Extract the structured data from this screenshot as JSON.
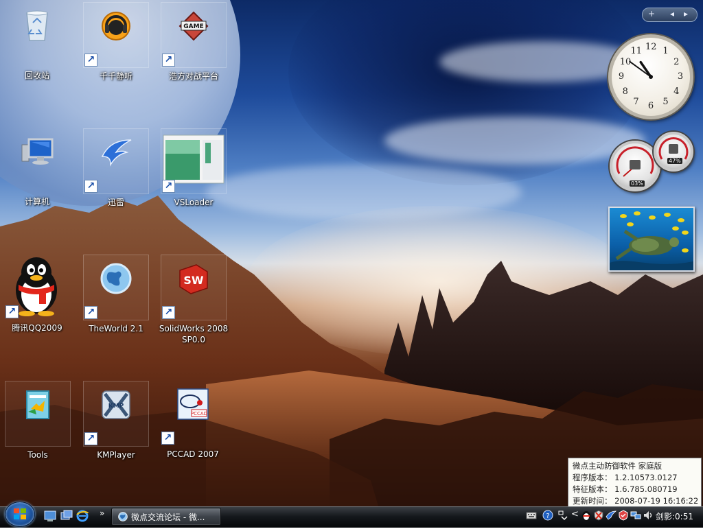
{
  "desktop_icons": [
    {
      "label": "回收站"
    },
    {
      "label": "千千静听"
    },
    {
      "label": "浩方对战平台"
    },
    {
      "label": "计算机"
    },
    {
      "label": "迅雷"
    },
    {
      "label": "VSLoader"
    },
    {
      "label": "腾讯QQ2009"
    },
    {
      "label": "TheWorld 2.1"
    },
    {
      "label": "SolidWorks 2008 SP0.0"
    },
    {
      "label": "Tools"
    },
    {
      "label": "KMPlayer"
    },
    {
      "label": "PCCAD 2007"
    }
  ],
  "gadgets": {
    "sidebar_controls": {
      "add": "+",
      "prev": "◂",
      "next": "▸"
    },
    "clock": {
      "hour": 10,
      "minute": 51,
      "numerals": [
        "12",
        "1",
        "2",
        "3",
        "4",
        "5",
        "6",
        "7",
        "8",
        "9",
        "10",
        "11"
      ]
    },
    "cpu_meter": {
      "cpu_value": "03%",
      "memory_value": "47%"
    },
    "slideshow_icon": "sea-turtle-photo"
  },
  "notification": {
    "line1": "微点主动防御软件  家庭版",
    "line2": "程序版本：  1.2.10573.0127",
    "line3": "特征版本：  1.6.785.080719",
    "line4": "更新时间：  2008-07-19 16:16:22"
  },
  "taskbar": {
    "active_window": "微点交流论坛 - 微...",
    "overflow": "»",
    "tray_chevron": "<",
    "clock": "剑影:0:51"
  },
  "colors": {
    "taskbar_top": "#3b3f44",
    "taskbar_bottom": "#050608",
    "popup_bg": "#fbfbf6",
    "label_text": "#ffffff"
  }
}
